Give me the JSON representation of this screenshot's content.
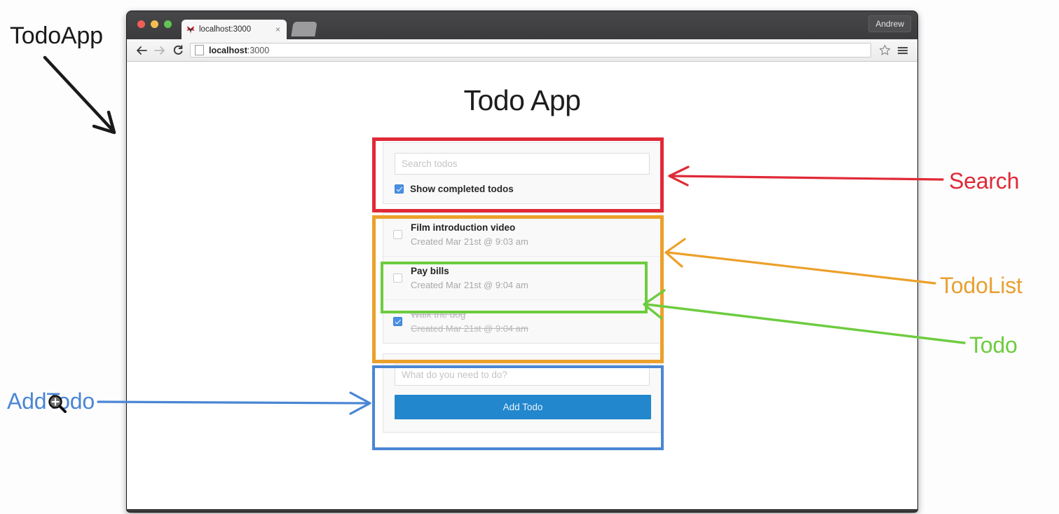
{
  "annotations": {
    "todoapp": "TodoApp",
    "addtodo": "AddTodo",
    "search": "Search",
    "todolist": "TodoList",
    "todo": "Todo",
    "colors": {
      "todoapp": "#1a1a1a",
      "search": "#e02a37",
      "todolist": "#eca02b",
      "todo": "#6dcc3f",
      "addtodo": "#4a86d4"
    }
  },
  "browser": {
    "tab": {
      "title": "localhost:3000",
      "close_label": "×"
    },
    "profile_label": "Andrew",
    "url": {
      "host": "localhost",
      "port": ":3000"
    }
  },
  "app": {
    "title": "Todo App",
    "search": {
      "placeholder": "Search todos",
      "value": "",
      "show_completed_label": "Show completed todos",
      "show_completed_checked": true
    },
    "todos": [
      {
        "title": "Film introduction video",
        "date": "Created Mar 21st @ 9:03 am",
        "completed": false
      },
      {
        "title": "Pay bills",
        "date": "Created Mar 21st @ 9:04 am",
        "completed": false
      },
      {
        "title": "Walk the dog",
        "date": "Created Mar 21st @ 9:04 am",
        "completed": true
      }
    ],
    "add_todo": {
      "placeholder": "What do you need to do?",
      "value": "",
      "button_label": "Add Todo"
    }
  }
}
